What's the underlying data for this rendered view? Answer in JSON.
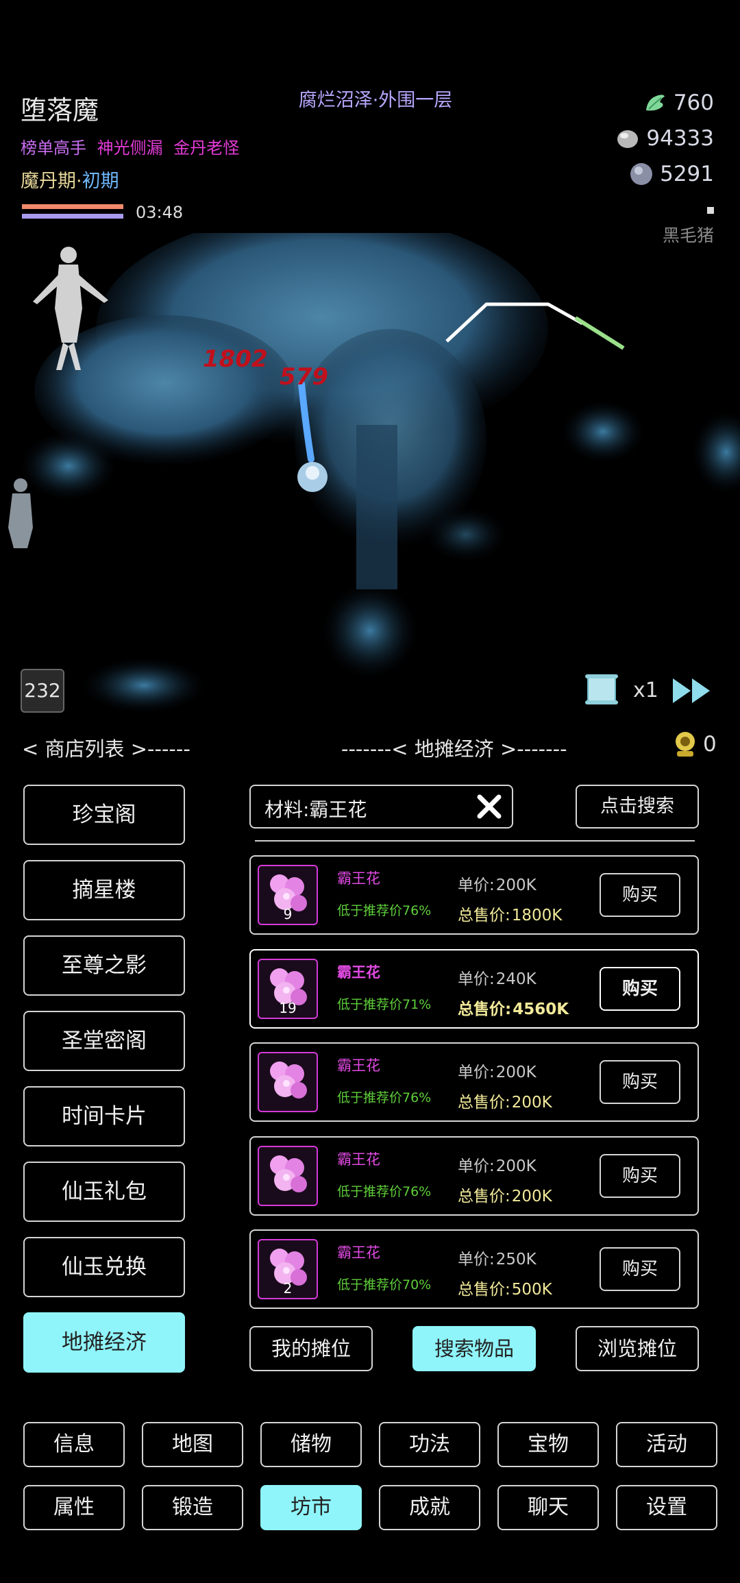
{
  "hud": {
    "player_name": "堕落魔",
    "location": "腐烂沼泽·外围一层",
    "titles": [
      {
        "text": "榜单高手",
        "color": "#c86df0"
      },
      {
        "text": "神光侧漏",
        "color": "#e33bd6"
      },
      {
        "text": "金丹老怪",
        "color": "#e33bd6"
      }
    ],
    "realm_stage": "魔丹期",
    "realm_separator": "·",
    "realm_level": "初期",
    "timer": "03:48",
    "resources": [
      {
        "icon": "jade-leaf-icon",
        "value": "760"
      },
      {
        "icon": "silver-stone-icon",
        "value": "94333"
      },
      {
        "icon": "spirit-orb-icon",
        "value": "5291"
      }
    ],
    "target_name": "黑毛猪",
    "colors": {
      "hp": "#f08a6a",
      "mp": "#a89bf0",
      "accent": "#8ff5fa"
    }
  },
  "battle": {
    "damage_numbers": [
      "1802",
      "579"
    ],
    "stage_badge": "232",
    "speed": "x1"
  },
  "market": {
    "shop_list_header": "< 商店列表 >------",
    "stall_header": "-------< 地摊经济 >-------",
    "ticket_count": "0",
    "shops": [
      {
        "label": "珍宝阁",
        "active": false
      },
      {
        "label": "摘星楼",
        "active": false
      },
      {
        "label": "至尊之影",
        "active": false
      },
      {
        "label": "圣堂密阁",
        "active": false
      },
      {
        "label": "时间卡片",
        "active": false
      },
      {
        "label": "仙玉礼包",
        "active": false
      },
      {
        "label": "仙玉兑换",
        "active": false
      },
      {
        "label": "地摊经济",
        "active": true
      }
    ],
    "search": {
      "value": "材料:霸王花",
      "button": "点击搜索"
    },
    "unit_price_label": "单价:",
    "total_price_label": "总售价:",
    "buy_label": "购买",
    "listings": [
      {
        "name": "霸王花",
        "qty": "9",
        "discount": "低于推荐价76%",
        "unit_price": "200K",
        "total_price": "1800K",
        "highlight": false
      },
      {
        "name": "霸王花",
        "qty": "19",
        "discount": "低于推荐价71%",
        "unit_price": "240K",
        "total_price": "4560K",
        "highlight": true
      },
      {
        "name": "霸王花",
        "qty": "",
        "discount": "低于推荐价76%",
        "unit_price": "200K",
        "total_price": "200K",
        "highlight": false
      },
      {
        "name": "霸王花",
        "qty": "",
        "discount": "低于推荐价76%",
        "unit_price": "200K",
        "total_price": "200K",
        "highlight": false
      },
      {
        "name": "霸王花",
        "qty": "2",
        "discount": "低于推荐价70%",
        "unit_price": "250K",
        "total_price": "500K",
        "highlight": false
      }
    ],
    "stall_tabs": [
      {
        "label": "我的摊位",
        "active": false
      },
      {
        "label": "搜索物品",
        "active": true
      },
      {
        "label": "浏览摊位",
        "active": false
      }
    ]
  },
  "nav": {
    "row1": [
      {
        "label": "信息",
        "active": false
      },
      {
        "label": "地图",
        "active": false
      },
      {
        "label": "储物",
        "active": false
      },
      {
        "label": "功法",
        "active": false
      },
      {
        "label": "宝物",
        "active": false
      },
      {
        "label": "活动",
        "active": false
      }
    ],
    "row2": [
      {
        "label": "属性",
        "active": false
      },
      {
        "label": "锻造",
        "active": false
      },
      {
        "label": "坊市",
        "active": true
      },
      {
        "label": "成就",
        "active": false
      },
      {
        "label": "聊天",
        "active": false
      },
      {
        "label": "设置",
        "active": false
      }
    ]
  }
}
